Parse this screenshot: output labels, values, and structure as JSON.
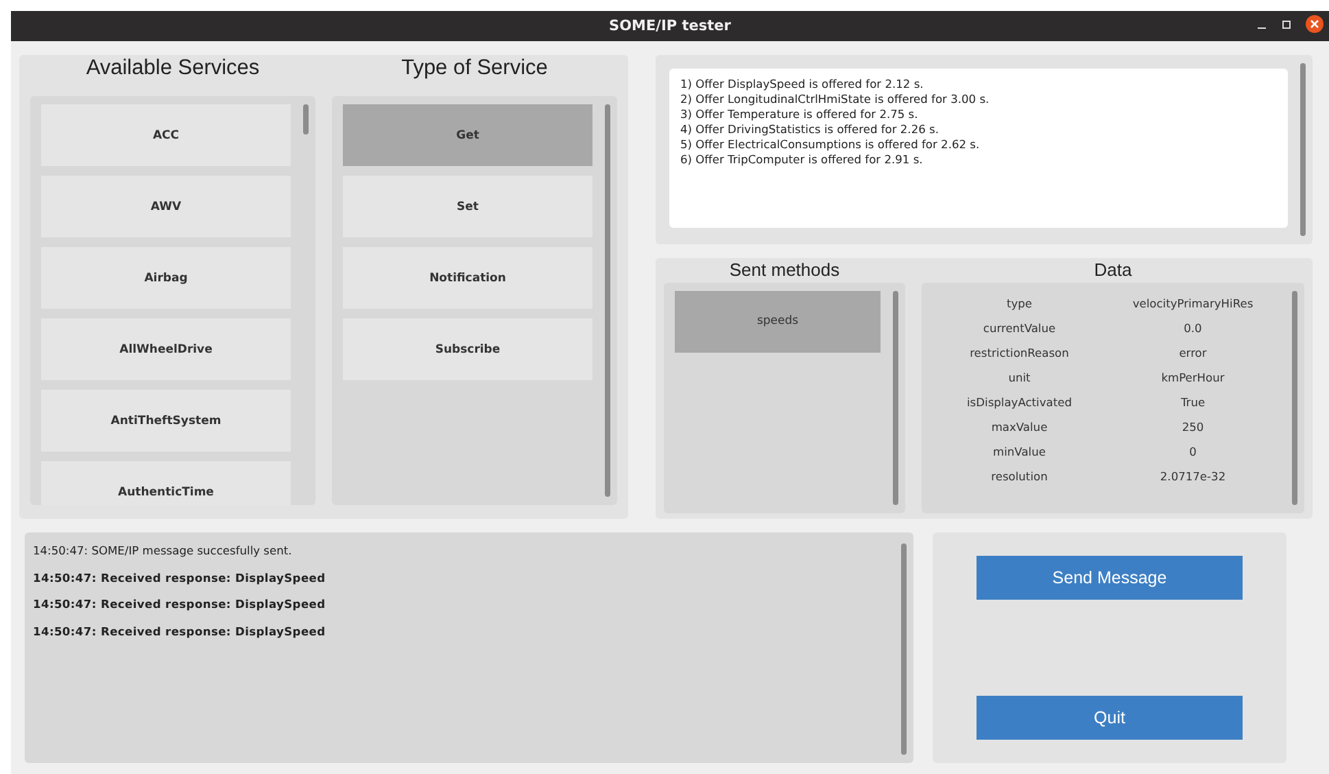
{
  "window": {
    "title": "SOME/IP tester"
  },
  "services": {
    "title": "Available Services",
    "items": [
      {
        "label": "ACC",
        "selected": false
      },
      {
        "label": "AWV",
        "selected": false
      },
      {
        "label": "Airbag",
        "selected": false
      },
      {
        "label": "AllWheelDrive",
        "selected": false
      },
      {
        "label": "AntiTheftSystem",
        "selected": false
      },
      {
        "label": "AuthenticTime",
        "selected": false
      }
    ]
  },
  "service_types": {
    "title": "Type of Service",
    "items": [
      {
        "label": "Get",
        "selected": true
      },
      {
        "label": "Set",
        "selected": false
      },
      {
        "label": "Notification",
        "selected": false
      },
      {
        "label": "Subscribe",
        "selected": false
      }
    ]
  },
  "offers": [
    "1) Offer DisplaySpeed is offered for 2.12 s.",
    "2) Offer LongitudinalCtrlHmiState is offered for 3.00 s.",
    "3) Offer Temperature is offered for 2.75 s.",
    "4) Offer DrivingStatistics is offered for 2.26 s.",
    "5) Offer ElectricalConsumptions is offered for 2.62 s.",
    "6) Offer TripComputer is offered for 2.91 s."
  ],
  "sent_methods": {
    "title": "Sent methods",
    "items": [
      {
        "label": "speeds",
        "selected": true
      }
    ]
  },
  "data": {
    "title": "Data",
    "rows": [
      {
        "key": "type",
        "value": "velocityPrimaryHiRes"
      },
      {
        "key": "currentValue",
        "value": "0.0"
      },
      {
        "key": "restrictionReason",
        "value": "error"
      },
      {
        "key": "unit",
        "value": "kmPerHour"
      },
      {
        "key": "isDisplayActivated",
        "value": "True"
      },
      {
        "key": "maxValue",
        "value": "250"
      },
      {
        "key": "minValue",
        "value": "0"
      },
      {
        "key": "resolution",
        "value": "2.0717e-32"
      }
    ]
  },
  "log": [
    {
      "text": "14:50:47: SOME/IP message succesfully sent.",
      "kind": "info"
    },
    {
      "text": "14:50:47: Received response:  DisplaySpeed",
      "kind": "response"
    },
    {
      "text": "14:50:47: Received response:  DisplaySpeed",
      "kind": "response"
    },
    {
      "text": "14:50:47: Received response:  DisplaySpeed",
      "kind": "response"
    }
  ],
  "buttons": [
    "Send Message",
    "Quit"
  ]
}
